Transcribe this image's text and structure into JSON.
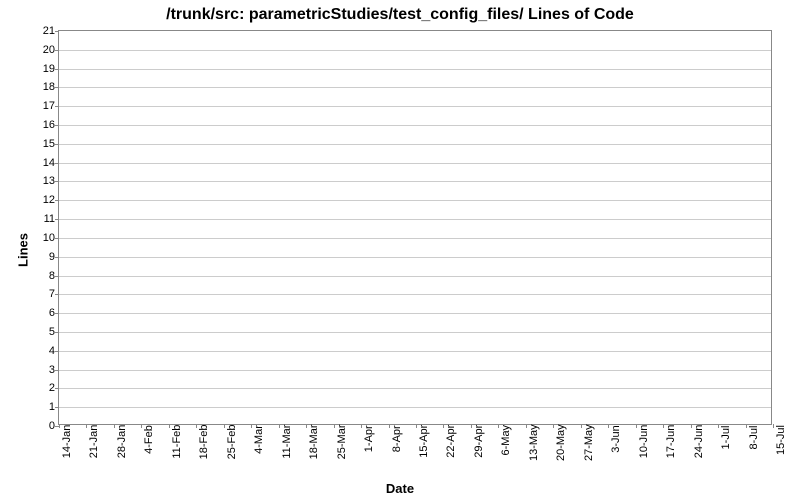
{
  "chart_data": {
    "type": "line",
    "title": "/trunk/src: parametricStudies/test_config_files/ Lines of Code",
    "xlabel": "Date",
    "ylabel": "Lines",
    "ylim": [
      0,
      21
    ],
    "yticks": [
      0,
      1,
      2,
      3,
      4,
      5,
      6,
      7,
      8,
      9,
      10,
      11,
      12,
      13,
      14,
      15,
      16,
      17,
      18,
      19,
      20,
      21
    ],
    "categories": [
      "14-Jan",
      "21-Jan",
      "28-Jan",
      "4-Feb",
      "11-Feb",
      "18-Feb",
      "25-Feb",
      "4-Mar",
      "11-Mar",
      "18-Mar",
      "25-Mar",
      "1-Apr",
      "8-Apr",
      "15-Apr",
      "22-Apr",
      "29-Apr",
      "6-May",
      "13-May",
      "20-May",
      "27-May",
      "3-Jun",
      "10-Jun",
      "17-Jun",
      "24-Jun",
      "1-Jul",
      "8-Jul",
      "15-Jul"
    ],
    "series": [
      {
        "name": "Lines of Code",
        "values": []
      }
    ],
    "grid": true
  }
}
